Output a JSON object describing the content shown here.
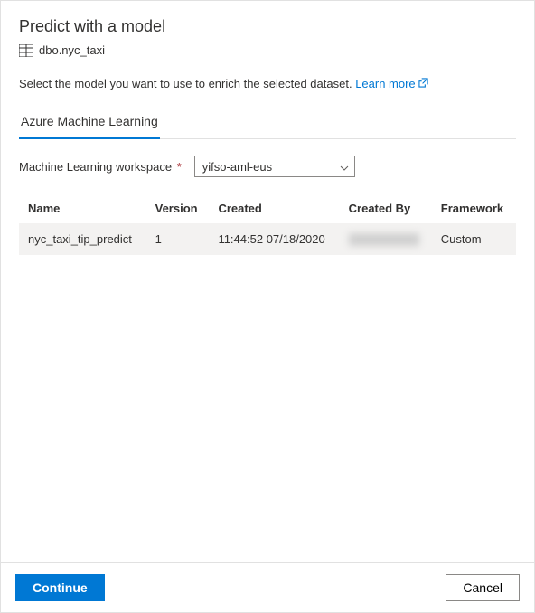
{
  "title": "Predict with a model",
  "dataset": "dbo.nyc_taxi",
  "instruction": "Select the model you want to use to enrich the selected dataset.",
  "learn_more": "Learn more",
  "tabs": [
    {
      "label": "Azure Machine Learning"
    }
  ],
  "workspace": {
    "label": "Machine Learning workspace",
    "required": "*",
    "value": "yifso-aml-eus"
  },
  "table": {
    "headers": [
      "Name",
      "Version",
      "Created",
      "Created By",
      "Framework"
    ],
    "rows": [
      {
        "name": "nyc_taxi_tip_predict",
        "version": "1",
        "created": "11:44:52 07/18/2020",
        "created_by": "",
        "framework": "Custom"
      }
    ]
  },
  "footer": {
    "continue": "Continue",
    "cancel": "Cancel"
  }
}
